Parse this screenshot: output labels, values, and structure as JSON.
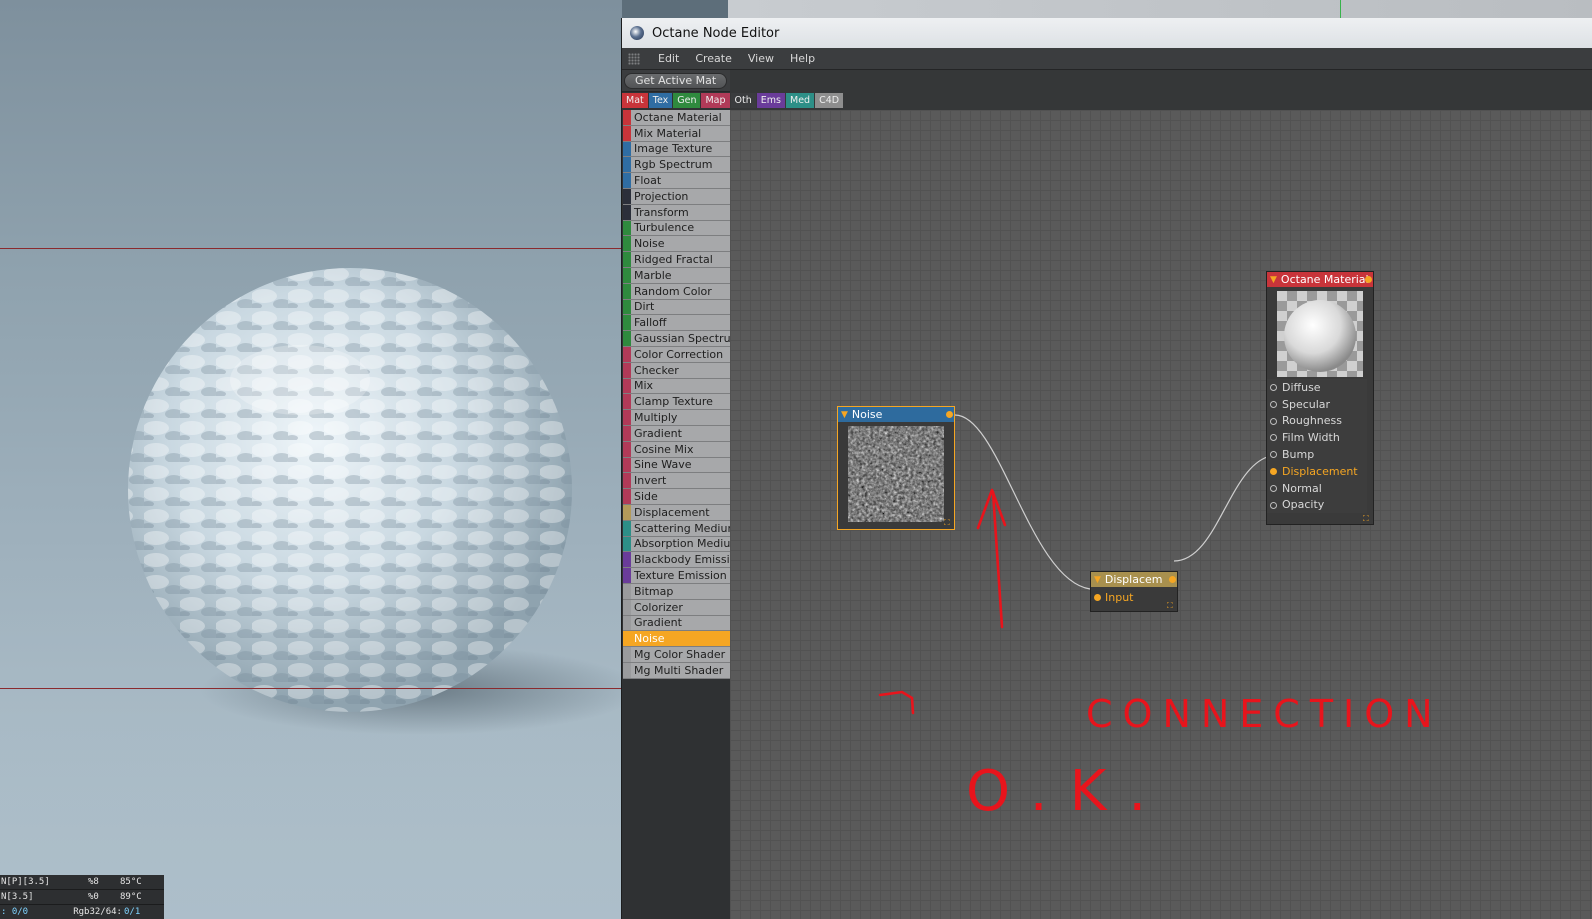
{
  "window": {
    "title": "Octane Node Editor"
  },
  "menu": {
    "items": [
      "Edit",
      "Create",
      "View",
      "Help"
    ]
  },
  "toolbar": {
    "get_active_mat": "Get Active Mat"
  },
  "tabs": [
    {
      "label": "Mat",
      "color": "#c8343a"
    },
    {
      "label": "Tex",
      "color": "#2f6da3"
    },
    {
      "label": "Gen",
      "color": "#2f8a3e"
    },
    {
      "label": "Map",
      "color": "#b13a58"
    },
    {
      "label": "Oth",
      "color": "#3a3c3e"
    },
    {
      "label": "Ems",
      "color": "#6a3c9a"
    },
    {
      "label": "Med",
      "color": "#2d8f87"
    },
    {
      "label": "C4D",
      "color": "#8e8e8e"
    }
  ],
  "node_list": [
    {
      "label": "Octane Material",
      "color": "#c8343a"
    },
    {
      "label": "Mix Material",
      "color": "#c8343a"
    },
    {
      "label": "Image Texture",
      "color": "#2f6da3"
    },
    {
      "label": "Rgb Spectrum",
      "color": "#2f6da3"
    },
    {
      "label": "Float",
      "color": "#2f6da3"
    },
    {
      "label": "Projection",
      "color": "#2b2f3a"
    },
    {
      "label": "Transform",
      "color": "#2b2f3a"
    },
    {
      "label": "Turbulence",
      "color": "#2f8a3e"
    },
    {
      "label": "Noise",
      "color": "#2f8a3e"
    },
    {
      "label": "Ridged Fractal",
      "color": "#2f8a3e"
    },
    {
      "label": "Marble",
      "color": "#2f8a3e"
    },
    {
      "label": "Random Color",
      "color": "#2f8a3e"
    },
    {
      "label": "Dirt",
      "color": "#2f8a3e"
    },
    {
      "label": "Falloff",
      "color": "#2f8a3e"
    },
    {
      "label": "Gaussian Spectrum",
      "color": "#2f8a3e"
    },
    {
      "label": "Color Correction",
      "color": "#b13a58"
    },
    {
      "label": "Checker",
      "color": "#b13a58"
    },
    {
      "label": "Mix",
      "color": "#b13a58"
    },
    {
      "label": "Clamp Texture",
      "color": "#b13a58"
    },
    {
      "label": "Multiply",
      "color": "#b13a58"
    },
    {
      "label": "Gradient",
      "color": "#b13a58"
    },
    {
      "label": "Cosine Mix",
      "color": "#b13a58"
    },
    {
      "label": "Sine Wave",
      "color": "#b13a58"
    },
    {
      "label": "Invert",
      "color": "#b13a58"
    },
    {
      "label": "Side",
      "color": "#b13a58"
    },
    {
      "label": "Displacement",
      "color": "#b39a5a"
    },
    {
      "label": "Scattering Medium",
      "color": "#2d8f87"
    },
    {
      "label": "Absorption Medium",
      "color": "#2d8f87"
    },
    {
      "label": "Blackbody Emission",
      "color": "#6a3c9a"
    },
    {
      "label": "Texture Emission",
      "color": "#6a3c9a"
    },
    {
      "label": "Bitmap",
      "color": "#9a9b9d"
    },
    {
      "label": "Colorizer",
      "color": "#9a9b9d"
    },
    {
      "label": "Gradient",
      "color": "#9a9b9d"
    },
    {
      "label": "Noise",
      "color": "#f5a623",
      "selected": true
    },
    {
      "label": "Mg Color Shader",
      "color": "#9a9b9d"
    },
    {
      "label": "Mg Multi Shader",
      "color": "#9a9b9d"
    }
  ],
  "nodes": {
    "noise": {
      "title": "Noise",
      "header_color": "#2e6b9e"
    },
    "displacement": {
      "title": "Displacem",
      "header_color": "#a8904e",
      "input": "Input"
    },
    "material": {
      "title": "Octane Material",
      "header_color": "#c8343a",
      "ports": [
        {
          "label": "Diffuse",
          "active": false
        },
        {
          "label": "Specular",
          "active": false
        },
        {
          "label": "Roughness",
          "active": false
        },
        {
          "label": "Film Width",
          "active": false
        },
        {
          "label": "Bump",
          "active": false
        },
        {
          "label": "Displacement",
          "active": true
        },
        {
          "label": "Normal",
          "active": false
        },
        {
          "label": "Opacity",
          "active": false
        }
      ]
    }
  },
  "annotation": {
    "color": "#e8141c",
    "text_line1": "CONNECTION",
    "text_line2": "O.K."
  },
  "stats": [
    {
      "c1": "N[P][3.5]",
      "c2": "%8",
      "c3": "85°C"
    },
    {
      "c1": "N[3.5]",
      "c2": "%0",
      "c3": "89°C"
    },
    {
      "c1": ": 0/0",
      "c2": "Rgb32/64:",
      "c3": "0/1"
    }
  ]
}
